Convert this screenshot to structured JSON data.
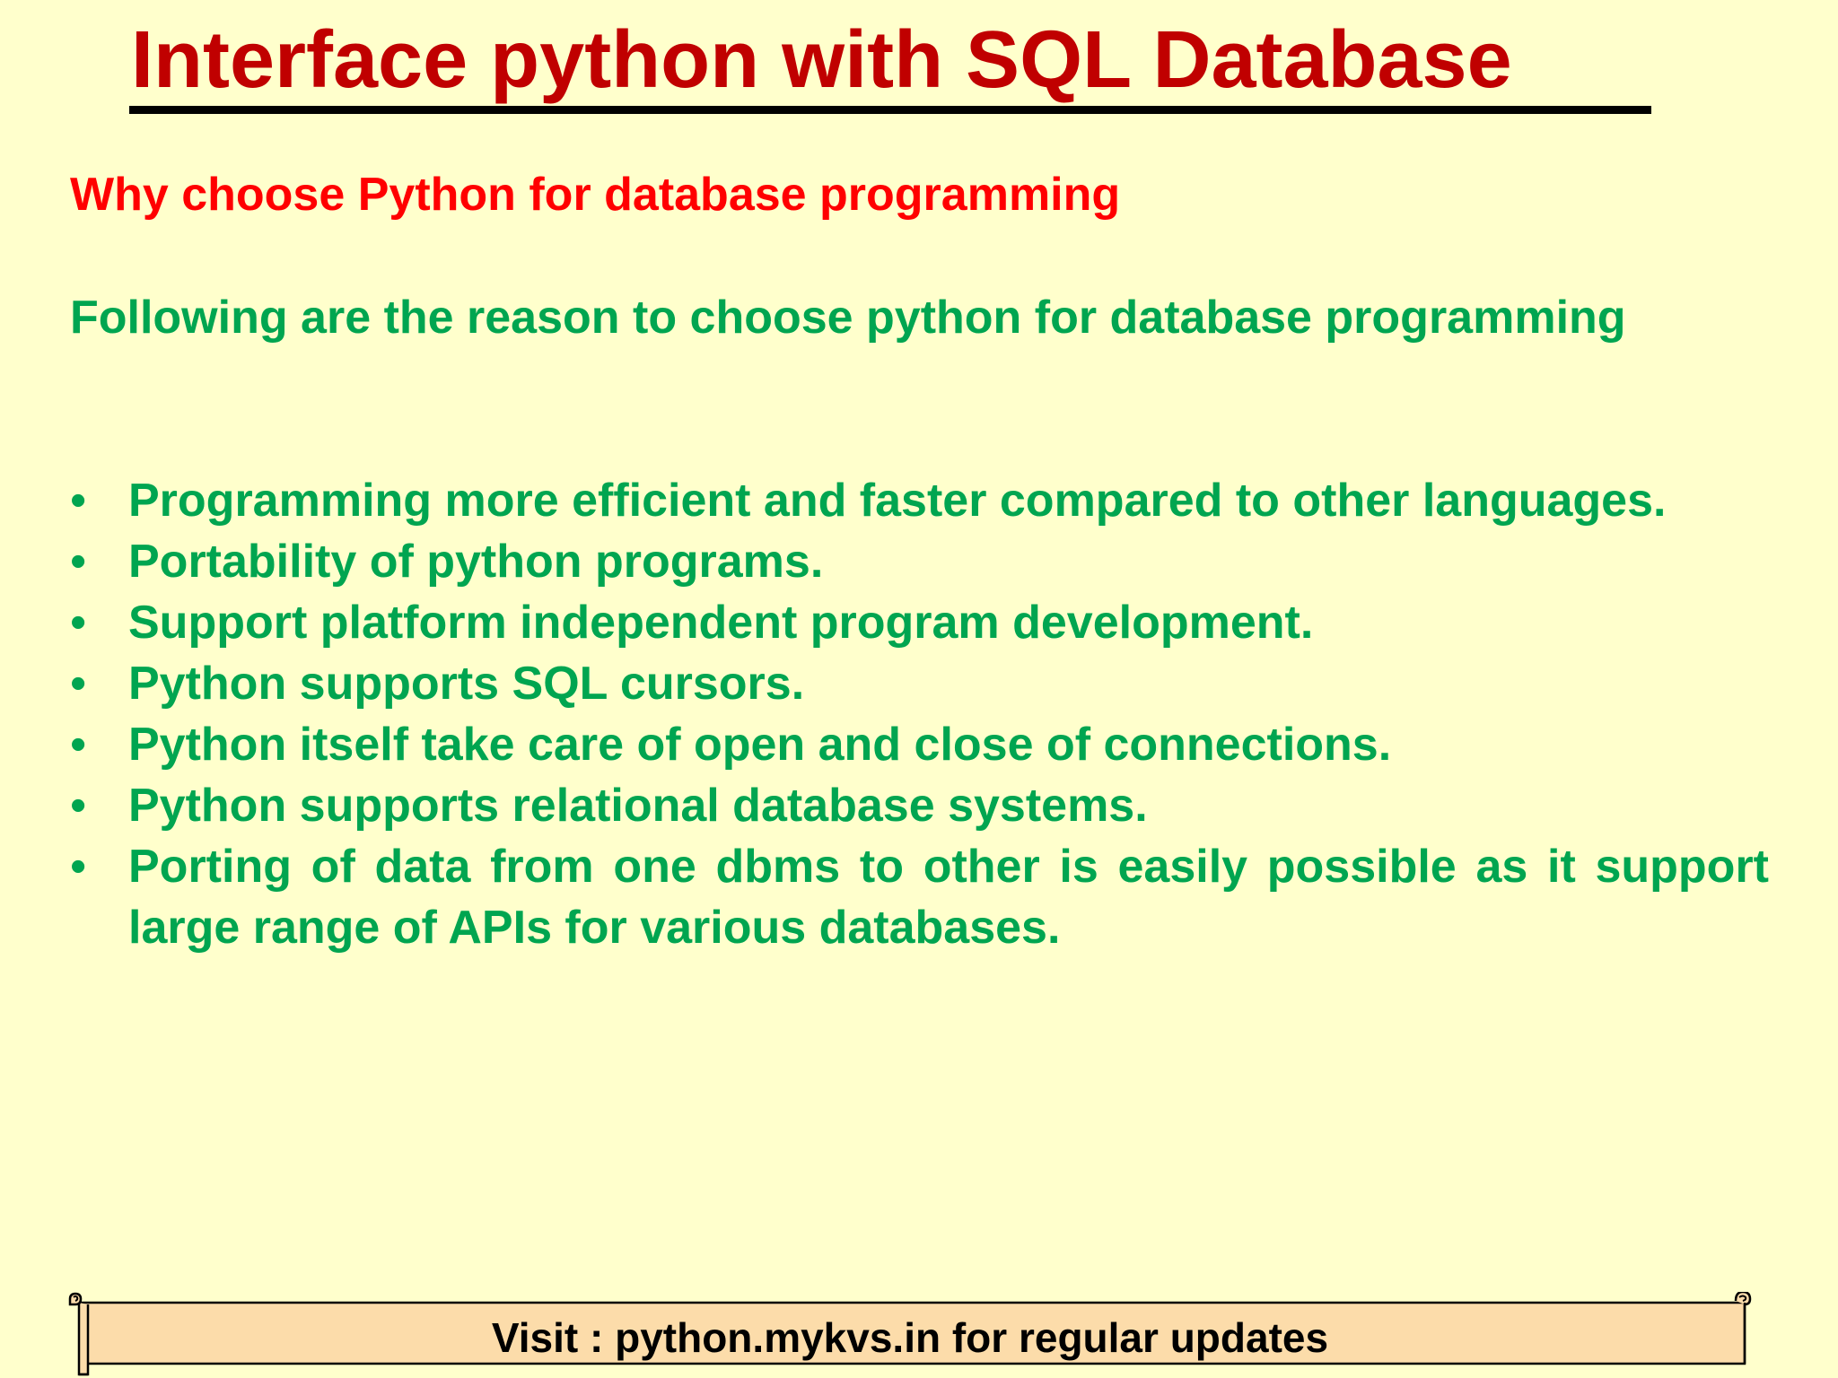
{
  "slide": {
    "title": "Interface python with SQL Database",
    "subtitle": "Why choose Python for database programming",
    "intro": "Following are the reason to choose python for database programming",
    "bullet_symbol": "•",
    "reasons": [
      "Programming more efficient and faster compared to other languages.",
      "Portability of python programs.",
      "Support platform independent program development.",
      "Python supports SQL cursors.",
      "Python itself take care of open and close of connections.",
      "Python supports relational database systems.",
      "Porting of data from one dbms to other is easily possible as it support large range of APIs for various databases."
    ],
    "footer": "Visit : python.mykvs.in for regular updates"
  },
  "colors": {
    "background": "#ffffcc",
    "title": "#c00000",
    "subtitle": "#ff0000",
    "body_text": "#00a550",
    "footer_fill": "#fcdcaa"
  },
  "icons": {
    "footer_banner": "scroll-icon"
  }
}
